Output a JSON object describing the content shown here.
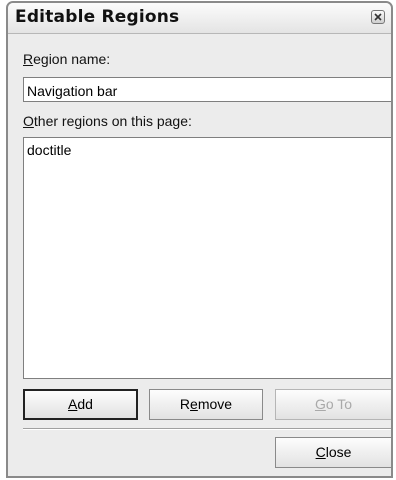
{
  "window": {
    "title": "Editable Regions"
  },
  "region_name": {
    "label_mnemonic": "R",
    "label_rest": "egion name:",
    "value": "Navigation bar"
  },
  "other_regions": {
    "label_mnemonic": "O",
    "label_rest": "ther regions on this page:",
    "items": [
      "doctitle"
    ]
  },
  "buttons": {
    "add": {
      "mnemonic": "A",
      "rest": "dd"
    },
    "remove": {
      "before": "R",
      "mnemonic": "e",
      "after": "move"
    },
    "goto": {
      "mnemonic": "G",
      "rest": "o To"
    },
    "close": {
      "mnemonic": "C",
      "rest": "lose"
    }
  },
  "icons": {
    "title_close": "close-icon"
  }
}
